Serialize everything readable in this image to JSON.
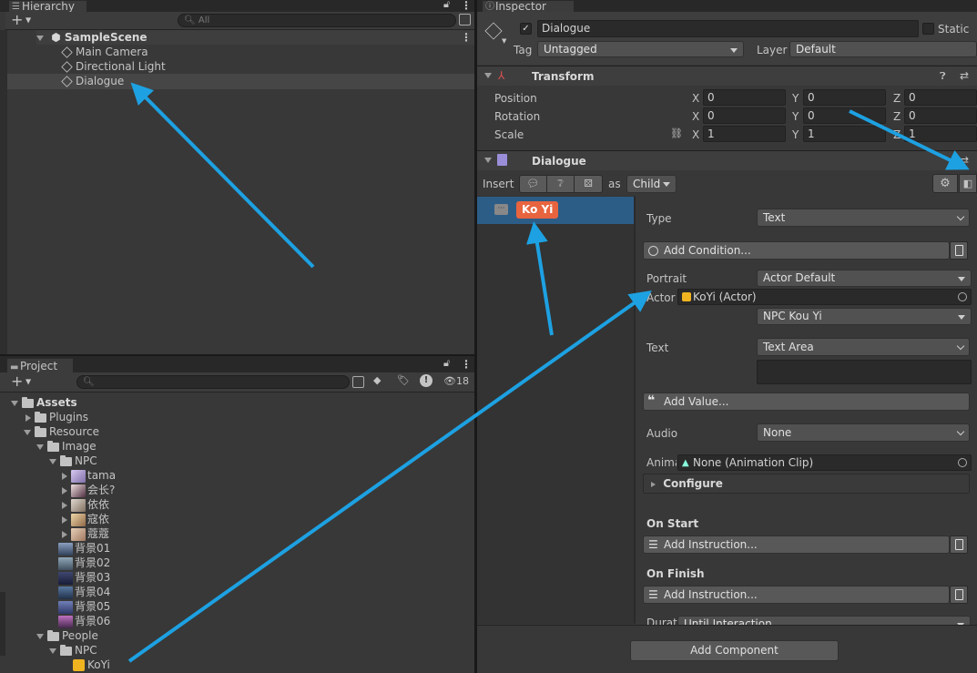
{
  "hierarchy": {
    "tab_label": "Hierarchy",
    "add_label": "+",
    "search_placeholder": "All",
    "scene_name": "SampleScene",
    "items": [
      "Main Camera",
      "Directional Light",
      "Dialogue"
    ]
  },
  "project": {
    "tab_label": "Project",
    "add_label": "+",
    "hidden_count": "18",
    "tree": {
      "assets": "Assets",
      "plugins": "Plugins",
      "resource": "Resource",
      "image": "Image",
      "npc": "NPC",
      "npc_items": [
        "tama",
        "会长?",
        "依依",
        "寇依",
        "蔻蔻"
      ],
      "backgrounds": [
        "背景01",
        "背景02",
        "背景03",
        "背景04",
        "背景05",
        "背景06"
      ],
      "people": "People",
      "people_npc": "NPC",
      "koyi": "KoYi"
    }
  },
  "inspector": {
    "tab_label": "Inspector",
    "object_name": "Dialogue",
    "static_label": "Static",
    "tag_label": "Tag",
    "tag_value": "Untagged",
    "layer_label": "Layer",
    "layer_value": "Default",
    "transform": {
      "title": "Transform",
      "rows": [
        {
          "label": "Position",
          "x": "0",
          "y": "0",
          "z": "0"
        },
        {
          "label": "Rotation",
          "x": "0",
          "y": "0",
          "z": "0"
        },
        {
          "label": "Scale",
          "x": "1",
          "y": "1",
          "z": "1"
        }
      ],
      "axis": [
        "X",
        "Y",
        "Z"
      ]
    },
    "dialogue": {
      "title": "Dialogue",
      "insert_label": "Insert",
      "as_label": "as",
      "as_value": "Child",
      "node_label": "Ko Yi",
      "type_label": "Type",
      "type_value": "Text",
      "add_condition": "Add Condition...",
      "portrait_label": "Portrait",
      "portrait_value": "Actor Default",
      "actor_label": "Actor",
      "actor_value": "KoYi (Actor)",
      "actor_sub_value": "NPC Kou Yi",
      "text_label": "Text",
      "text_value": "Text Area",
      "add_value": "Add Value...",
      "audio_label": "Audio",
      "audio_value": "None",
      "anim_label": "Anima",
      "anim_value": "None (Animation Clip)",
      "configure": "Configure",
      "on_start": "On Start",
      "on_finish": "On Finish",
      "add_instruction": "Add Instruction...",
      "duration_label": "Durat",
      "duration_value": "Until Interaction"
    },
    "add_component": "Add Component"
  },
  "colors": {
    "accent_arrow": "#1da1e2",
    "selection": "#2c5d87",
    "node_badge": "#e7643f"
  }
}
